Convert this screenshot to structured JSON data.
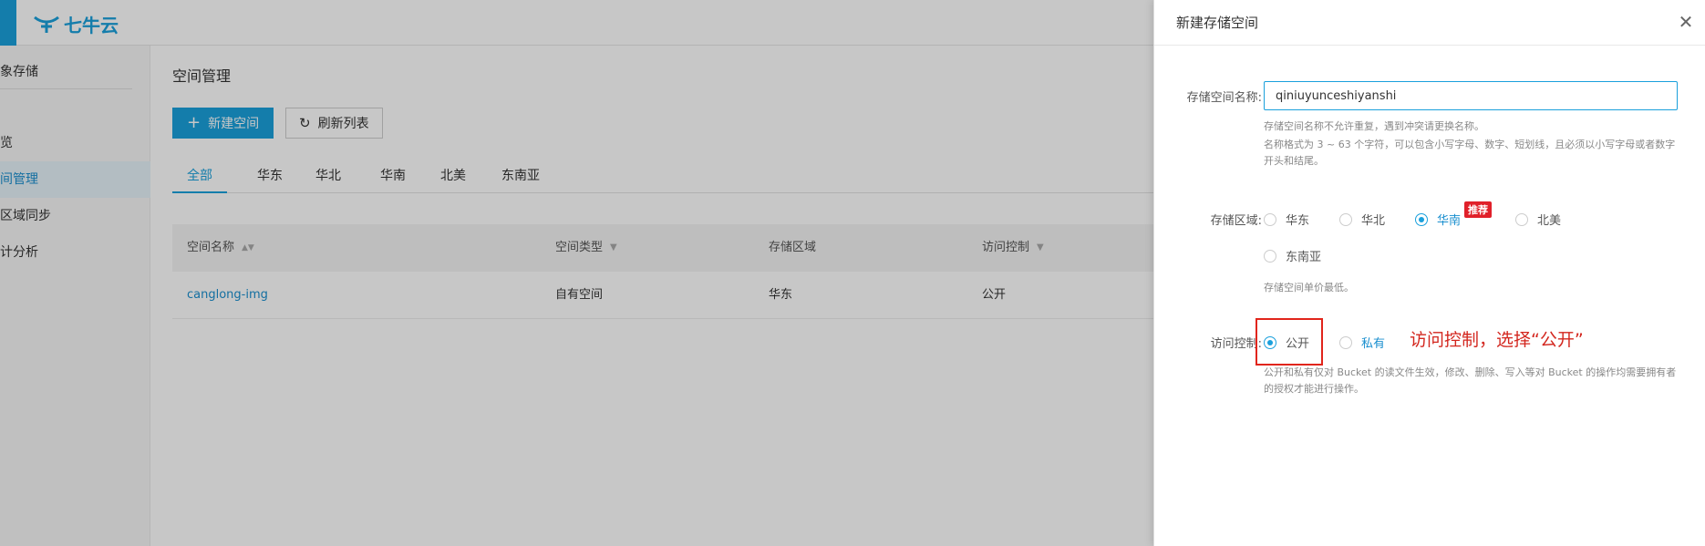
{
  "brand": {
    "name": "七牛云",
    "accent": "#1aa0dc"
  },
  "sidebar": {
    "section": "象存储",
    "items": [
      {
        "label": "览"
      },
      {
        "label": "间管理"
      },
      {
        "label": "区域同步"
      },
      {
        "label": "计分析"
      }
    ]
  },
  "main": {
    "title": "空间管理",
    "new_button": "新建空间",
    "refresh_button": "刷新列表",
    "tabs": [
      "全部",
      "华东",
      "华北",
      "华南",
      "北美",
      "东南亚"
    ],
    "table": {
      "headers": [
        "空间名称",
        "空间类型",
        "存储区域",
        "访问控制"
      ],
      "rows": [
        {
          "name": "canglong-img",
          "type": "自有空间",
          "region": "华东",
          "access": "公开"
        }
      ]
    }
  },
  "drawer": {
    "title": "新建存储空间",
    "name_label": "存储空间名称:",
    "name_value": "qiniuyunceshiyanshi",
    "name_help_1": "存储空间名称不允许重复，遇到冲突请更换名称。",
    "name_help_2": "名称格式为 3 ~ 63 个字符，可以包含小写字母、数字、短划线，且必须以小写字母或者数字开头和结尾。",
    "region_label": "存储区域:",
    "regions": [
      "华东",
      "华北",
      "华南",
      "北美",
      "东南亚"
    ],
    "region_selected": "华南",
    "recommend_badge": "推荐",
    "region_help": "存储空间单价最低。",
    "access_label": "访问控制:",
    "access_options": [
      "公开",
      "私有"
    ],
    "access_selected": "公开",
    "access_help": "公开和私有仅对 Bucket 的读文件生效，修改、删除、写入等对 Bucket 的操作均需要拥有者的授权才能进行操作。",
    "annotation": "访问控制，选择“公开”",
    "annotation_color": "#d3261e"
  }
}
